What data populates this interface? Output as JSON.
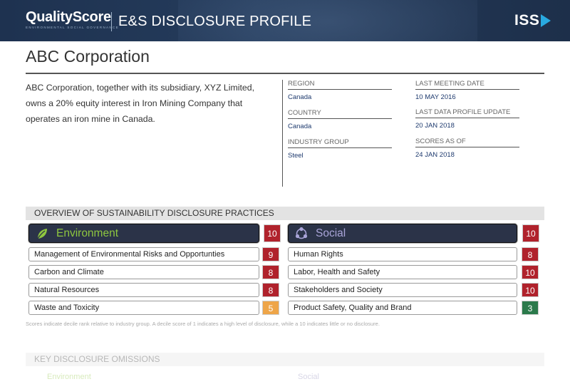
{
  "header": {
    "brand": "QualityScore",
    "brand_tagline": "ENVIRONMENTAL SOCIAL GOVERNANCE",
    "title": "E&S DISCLOSURE PROFILE",
    "logo": "ISS",
    "background_color": "#1e3250",
    "logo_accent_color": "#29a9e0"
  },
  "company": {
    "name": "ABC Corporation",
    "description": "ABC Corporation, together with its subsidiary, XYZ Limited, owns a 20% equity interest in Iron Mining Company that operates an iron mine in Canada."
  },
  "meta": {
    "region": {
      "label": "REGION",
      "value": "Canada"
    },
    "country": {
      "label": "COUNTRY",
      "value": "Canada"
    },
    "industry_group": {
      "label": "INDUSTRY GROUP",
      "value": "Steel"
    },
    "last_meeting_date": {
      "label": "LAST MEETING DATE",
      "value": "10 MAY 2016"
    },
    "last_data_profile_update": {
      "label": "LAST DATA PROFILE UPDATE",
      "value": "20 JAN 2018"
    },
    "scores_as_of": {
      "label": "SCORES AS OF",
      "value": "24 JAN 2018"
    }
  },
  "overview": {
    "title": "OVERVIEW OF SUSTAINABILITY DISCLOSURE PRACTICES",
    "environment": {
      "label": "Environment",
      "icon": "leaf-icon",
      "score": "10",
      "items": [
        {
          "label": "Management of Environmental Risks and Opportunties",
          "score": "9",
          "color": "#b0222c"
        },
        {
          "label": "Carbon and Climate",
          "score": "8",
          "color": "#b0222c"
        },
        {
          "label": "Natural Resources",
          "score": "8",
          "color": "#b0222c"
        },
        {
          "label": "Waste and Toxicity",
          "score": "5",
          "color": "#eea548"
        }
      ]
    },
    "social": {
      "label": "Social",
      "icon": "people-network-icon",
      "score": "10",
      "items": [
        {
          "label": "Human Rights",
          "score": "8",
          "color": "#b0222c"
        },
        {
          "label": "Labor, Health and Safety",
          "score": "10",
          "color": "#b0222c"
        },
        {
          "label": "Stakeholders and Society",
          "score": "10",
          "color": "#b0222c"
        },
        {
          "label": "Product Safety, Quality and Brand",
          "score": "3",
          "color": "#2b7a4b"
        }
      ]
    },
    "note": "Scores indicate decile rank relative to industry group. A decile score of 1 indicates a high level of disclosure, while a 10 indicates little or no disclosure."
  },
  "omissions": {
    "title": "KEY DISCLOSURE OMISSIONS",
    "environment_label": "Environment",
    "social_label": "Social"
  }
}
